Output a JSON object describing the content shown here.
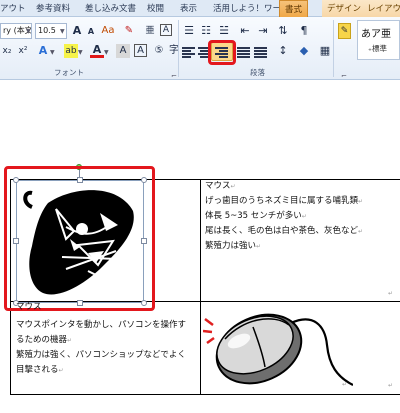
{
  "tabs": {
    "layout_partial": "アウト",
    "references": "参考資料",
    "mailings": "差し込み文書",
    "review": "校閲",
    "view": "表示",
    "addin": "活用しよう！ワード",
    "format": "書式",
    "design": "デザイン",
    "layout": "レイアウ"
  },
  "font_group": {
    "font_name": "ry (本文",
    "font_size": "10.5",
    "label": "フォント"
  },
  "paragraph_group": {
    "label": "段落"
  },
  "styles_group": {
    "sample": "あア亜",
    "name": "₊標準"
  },
  "document": {
    "cell_top_right": [
      "マウス",
      "げっ歯目のうちネズミ目に属する哺乳類",
      "体長 5~35 センチが多い",
      "尾は長く、毛の色は白や茶色、灰色など",
      "繁殖力は強い"
    ],
    "mouse_caption": "マウス",
    "cell_bottom_left": [
      "マウスポインタを動かし、パソコンを操作す",
      "るための機器",
      "繁殖力は強く、パソコンショップなどでよく",
      "目撃される"
    ]
  },
  "colors": {
    "highlight_red": "#e3171d",
    "context_tab": "#f0a848",
    "ribbon_bg": "#e5edf7"
  }
}
